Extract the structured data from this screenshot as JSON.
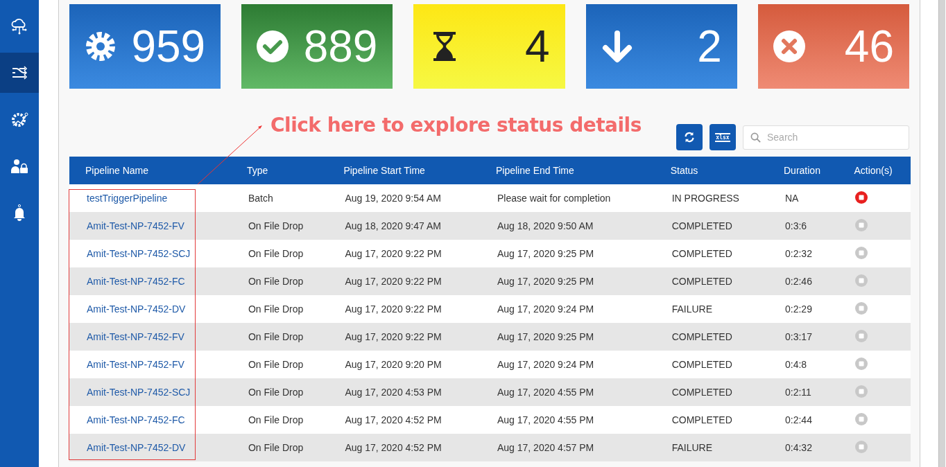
{
  "sidebar": {
    "items": [
      {
        "kind": "cloud",
        "selected": false
      },
      {
        "kind": "flows",
        "selected": true
      },
      {
        "kind": "gear-network",
        "selected": false
      },
      {
        "kind": "user-lock",
        "selected": false
      },
      {
        "kind": "bell",
        "selected": false
      }
    ]
  },
  "cards": [
    {
      "kind": "total",
      "value": "959"
    },
    {
      "kind": "completed",
      "value": "889"
    },
    {
      "kind": "waiting",
      "value": "4"
    },
    {
      "kind": "queued",
      "value": "2"
    },
    {
      "kind": "failed",
      "value": "46"
    }
  ],
  "annotation": {
    "text": "Click here to explore status details"
  },
  "toolbar": {
    "export_label": "xlsx",
    "search": {
      "placeholder": "Search"
    }
  },
  "table": {
    "columns": [
      "Pipeline Name",
      "Type",
      "Pipeline Start Time",
      "Pipeline End Time",
      "Status",
      "Duration",
      "Action(s)"
    ],
    "rows": [
      {
        "name": "testTriggerPipeline",
        "type": "Batch",
        "start": "Aug 19, 2020 9:54 AM",
        "end": "Please wait for completion",
        "status": "IN PROGRESS",
        "duration": "NA",
        "stop_enabled": true
      },
      {
        "name": "Amit-Test-NP-7452-FV",
        "type": "On File Drop",
        "start": "Aug 18, 2020 9:47 AM",
        "end": "Aug 18, 2020 9:50 AM",
        "status": "COMPLETED",
        "duration": "0:3:6",
        "stop_enabled": false
      },
      {
        "name": "Amit-Test-NP-7452-SCJ",
        "type": "On File Drop",
        "start": "Aug 17, 2020 9:22 PM",
        "end": "Aug 17, 2020 9:25 PM",
        "status": "COMPLETED",
        "duration": "0:2:32",
        "stop_enabled": false
      },
      {
        "name": "Amit-Test-NP-7452-FC",
        "type": "On File Drop",
        "start": "Aug 17, 2020 9:22 PM",
        "end": "Aug 17, 2020 9:25 PM",
        "status": "COMPLETED",
        "duration": "0:2:46",
        "stop_enabled": false
      },
      {
        "name": "Amit-Test-NP-7452-DV",
        "type": "On File Drop",
        "start": "Aug 17, 2020 9:22 PM",
        "end": "Aug 17, 2020 9:24 PM",
        "status": "FAILURE",
        "duration": "0:2:29",
        "stop_enabled": false
      },
      {
        "name": "Amit-Test-NP-7452-FV",
        "type": "On File Drop",
        "start": "Aug 17, 2020 9:22 PM",
        "end": "Aug 17, 2020 9:25 PM",
        "status": "COMPLETED",
        "duration": "0:3:17",
        "stop_enabled": false
      },
      {
        "name": "Amit-Test-NP-7452-FV",
        "type": "On File Drop",
        "start": "Aug 17, 2020 9:20 PM",
        "end": "Aug 17, 2020 9:24 PM",
        "status": "COMPLETED",
        "duration": "0:4:8",
        "stop_enabled": false
      },
      {
        "name": "Amit-Test-NP-7452-SCJ",
        "type": "On File Drop",
        "start": "Aug 17, 2020 4:53 PM",
        "end": "Aug 17, 2020 4:55 PM",
        "status": "COMPLETED",
        "duration": "0:2:11",
        "stop_enabled": false
      },
      {
        "name": "Amit-Test-NP-7452-FC",
        "type": "On File Drop",
        "start": "Aug 17, 2020 4:52 PM",
        "end": "Aug 17, 2020 4:55 PM",
        "status": "COMPLETED",
        "duration": "0:2:44",
        "stop_enabled": false
      },
      {
        "name": "Amit-Test-NP-7452-DV",
        "type": "On File Drop",
        "start": "Aug 17, 2020 4:52 PM",
        "end": "Aug 17, 2020 4:57 PM",
        "status": "FAILURE",
        "duration": "0:4:32",
        "stop_enabled": false
      }
    ]
  }
}
